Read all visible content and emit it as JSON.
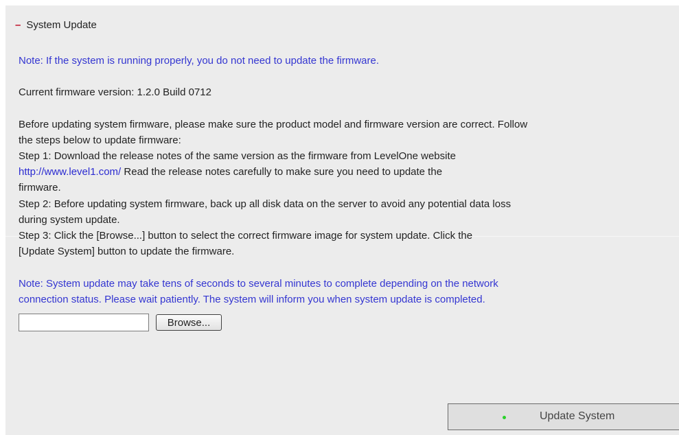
{
  "section": {
    "toggle_symbol": "–",
    "title": "System Update"
  },
  "note_top": "Note: If the system is running properly, you do not need to update the firmware.",
  "firmware": {
    "current_version_text": "Current firmware version: 1.2.0 Build 0712"
  },
  "instructions": {
    "intro_line1": "Before updating system firmware, please make sure the product model and firmware version are correct. Follow",
    "intro_line2": "the steps below to update firmware:",
    "step1_line1": "Step 1: Download the release notes of the same version as the firmware from LevelOne website",
    "step1_link": "http://www.level1.com/",
    "step1_line2_rest": " Read the release notes carefully to make sure you need to update the",
    "step1_line3": "firmware.",
    "step2_line1": "Step 2: Before updating system firmware, back up all disk data on the server to avoid any potential data loss",
    "step2_line2": "during system update.",
    "step3_line1": "Step 3: Click the [Browse...] button to select the correct firmware image for system update. Click the",
    "step3_line2": "[Update System] button to update the firmware."
  },
  "note_bottom": {
    "line1": "Note: System update may take tens of seconds to several minutes to complete depending on the network",
    "line2": "connection status. Please wait patiently. The system will inform you when system update is completed."
  },
  "file_select": {
    "value": "",
    "browse_label": "Browse..."
  },
  "update_button": {
    "label": "Update System",
    "status_color": "#2bd12b"
  },
  "colors": {
    "note_text": "#3436d1",
    "link": "#2b2bd1",
    "toggle": "#c0102a",
    "panel_bg": "#ececec"
  }
}
